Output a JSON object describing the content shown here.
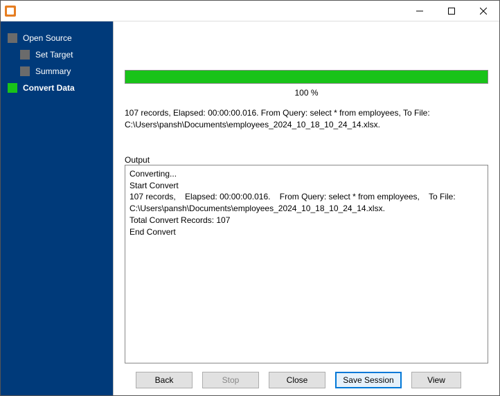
{
  "window": {
    "title": ""
  },
  "sidebar": {
    "items": [
      {
        "label": "Open Source",
        "level": 0,
        "active": false
      },
      {
        "label": "Set Target",
        "level": 1,
        "active": false
      },
      {
        "label": "Summary",
        "level": 1,
        "active": false
      },
      {
        "label": "Convert Data",
        "level": 0,
        "active": true
      }
    ]
  },
  "progress": {
    "percent_text": "100 %",
    "value": 100
  },
  "summary_line": "107 records,    Elapsed: 00:00:00.016.    From Query: select * from employees,    To File: C:\\Users\\pansh\\Documents\\employees_2024_10_18_10_24_14.xlsx.",
  "output": {
    "label": "Output",
    "lines": [
      "Converting...",
      "Start Convert",
      "107 records,    Elapsed: 00:00:00.016.    From Query: select * from employees,    To File: C:\\Users\\pansh\\Documents\\employees_2024_10_18_10_24_14.xlsx.",
      "Total Convert Records: 107",
      "End Convert"
    ]
  },
  "buttons": {
    "back": "Back",
    "stop": "Stop",
    "close": "Close",
    "save_session": "Save Session",
    "view": "View"
  }
}
